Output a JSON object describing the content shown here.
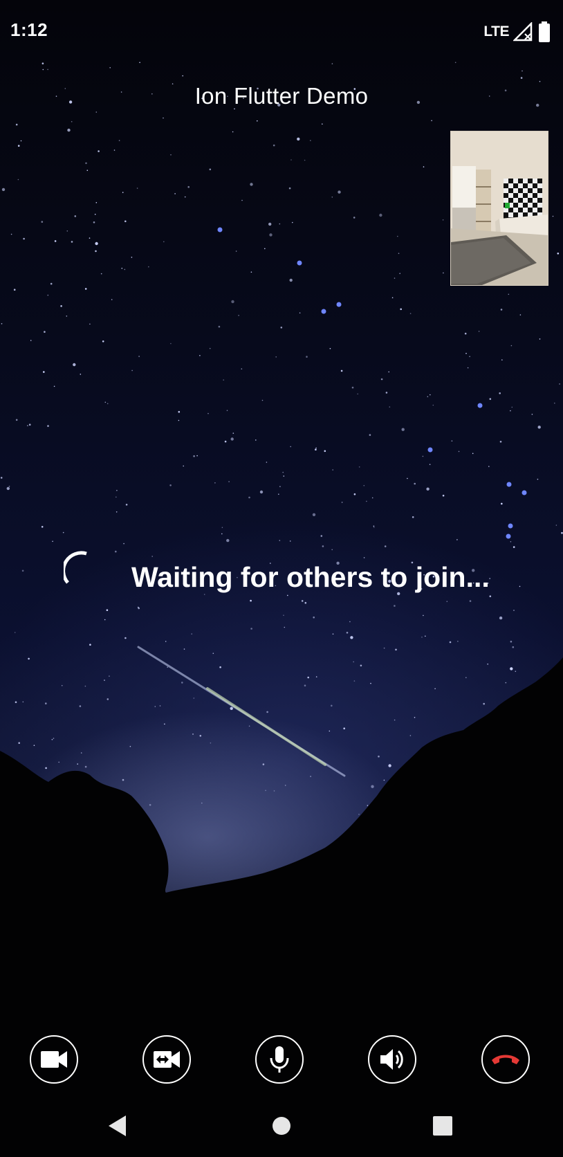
{
  "status_bar": {
    "time": "1:12",
    "network": "LTE",
    "icons": [
      "signal-icon",
      "battery-icon"
    ]
  },
  "app": {
    "title": "Ion Flutter Demo"
  },
  "call": {
    "waiting_text": "Waiting for others to join..."
  },
  "controls": [
    {
      "name": "video-camera-button",
      "icon": "video-camera-icon"
    },
    {
      "name": "switch-camera-button",
      "icon": "switch-camera-icon"
    },
    {
      "name": "microphone-button",
      "icon": "microphone-icon"
    },
    {
      "name": "speaker-button",
      "icon": "speaker-icon"
    },
    {
      "name": "hang-up-button",
      "icon": "hang-up-icon"
    }
  ],
  "navigation": [
    "back-icon",
    "home-icon",
    "recents-icon"
  ],
  "colors": {
    "hang_up": "#e53935",
    "text": "#ffffff",
    "background": "#000000"
  }
}
